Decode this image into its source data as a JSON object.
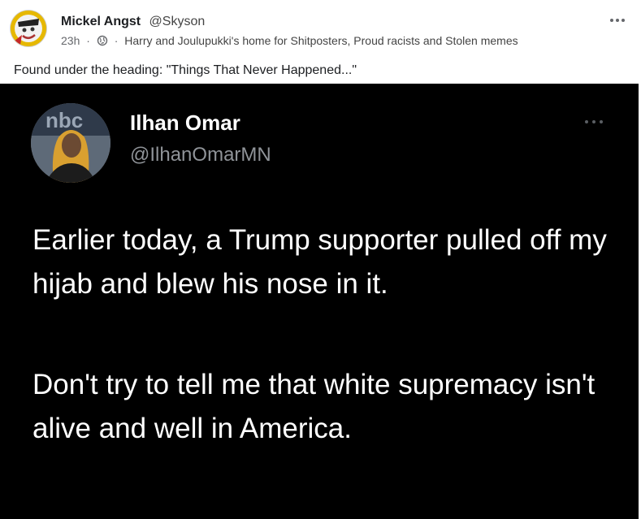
{
  "post": {
    "author_name": "Mickel Angst",
    "author_handle": "@Skyson",
    "time": "23h",
    "separator": "·",
    "group_name": "Harry and Joulupukki's home for Shitposters, Proud racists and Stolen memes",
    "caption": "Found under the heading: \"Things That Never Happened...\""
  },
  "tweet": {
    "name": "Ilhan Omar",
    "handle": "@IlhanOmarMN",
    "paragraph1": "Earlier today, a Trump supporter pulled off my hijab and blew his nose in it.",
    "paragraph2": "Don't try to tell me that white supremacy isn't alive and well in America."
  },
  "icons": {
    "privacy": "globe-icon",
    "more": "more-horizontal-icon"
  },
  "colors": {
    "avatar_accent": "#e6b800",
    "tweet_background": "#000000",
    "tweet_text": "#ffffff",
    "tweet_handle": "#8f9398"
  }
}
